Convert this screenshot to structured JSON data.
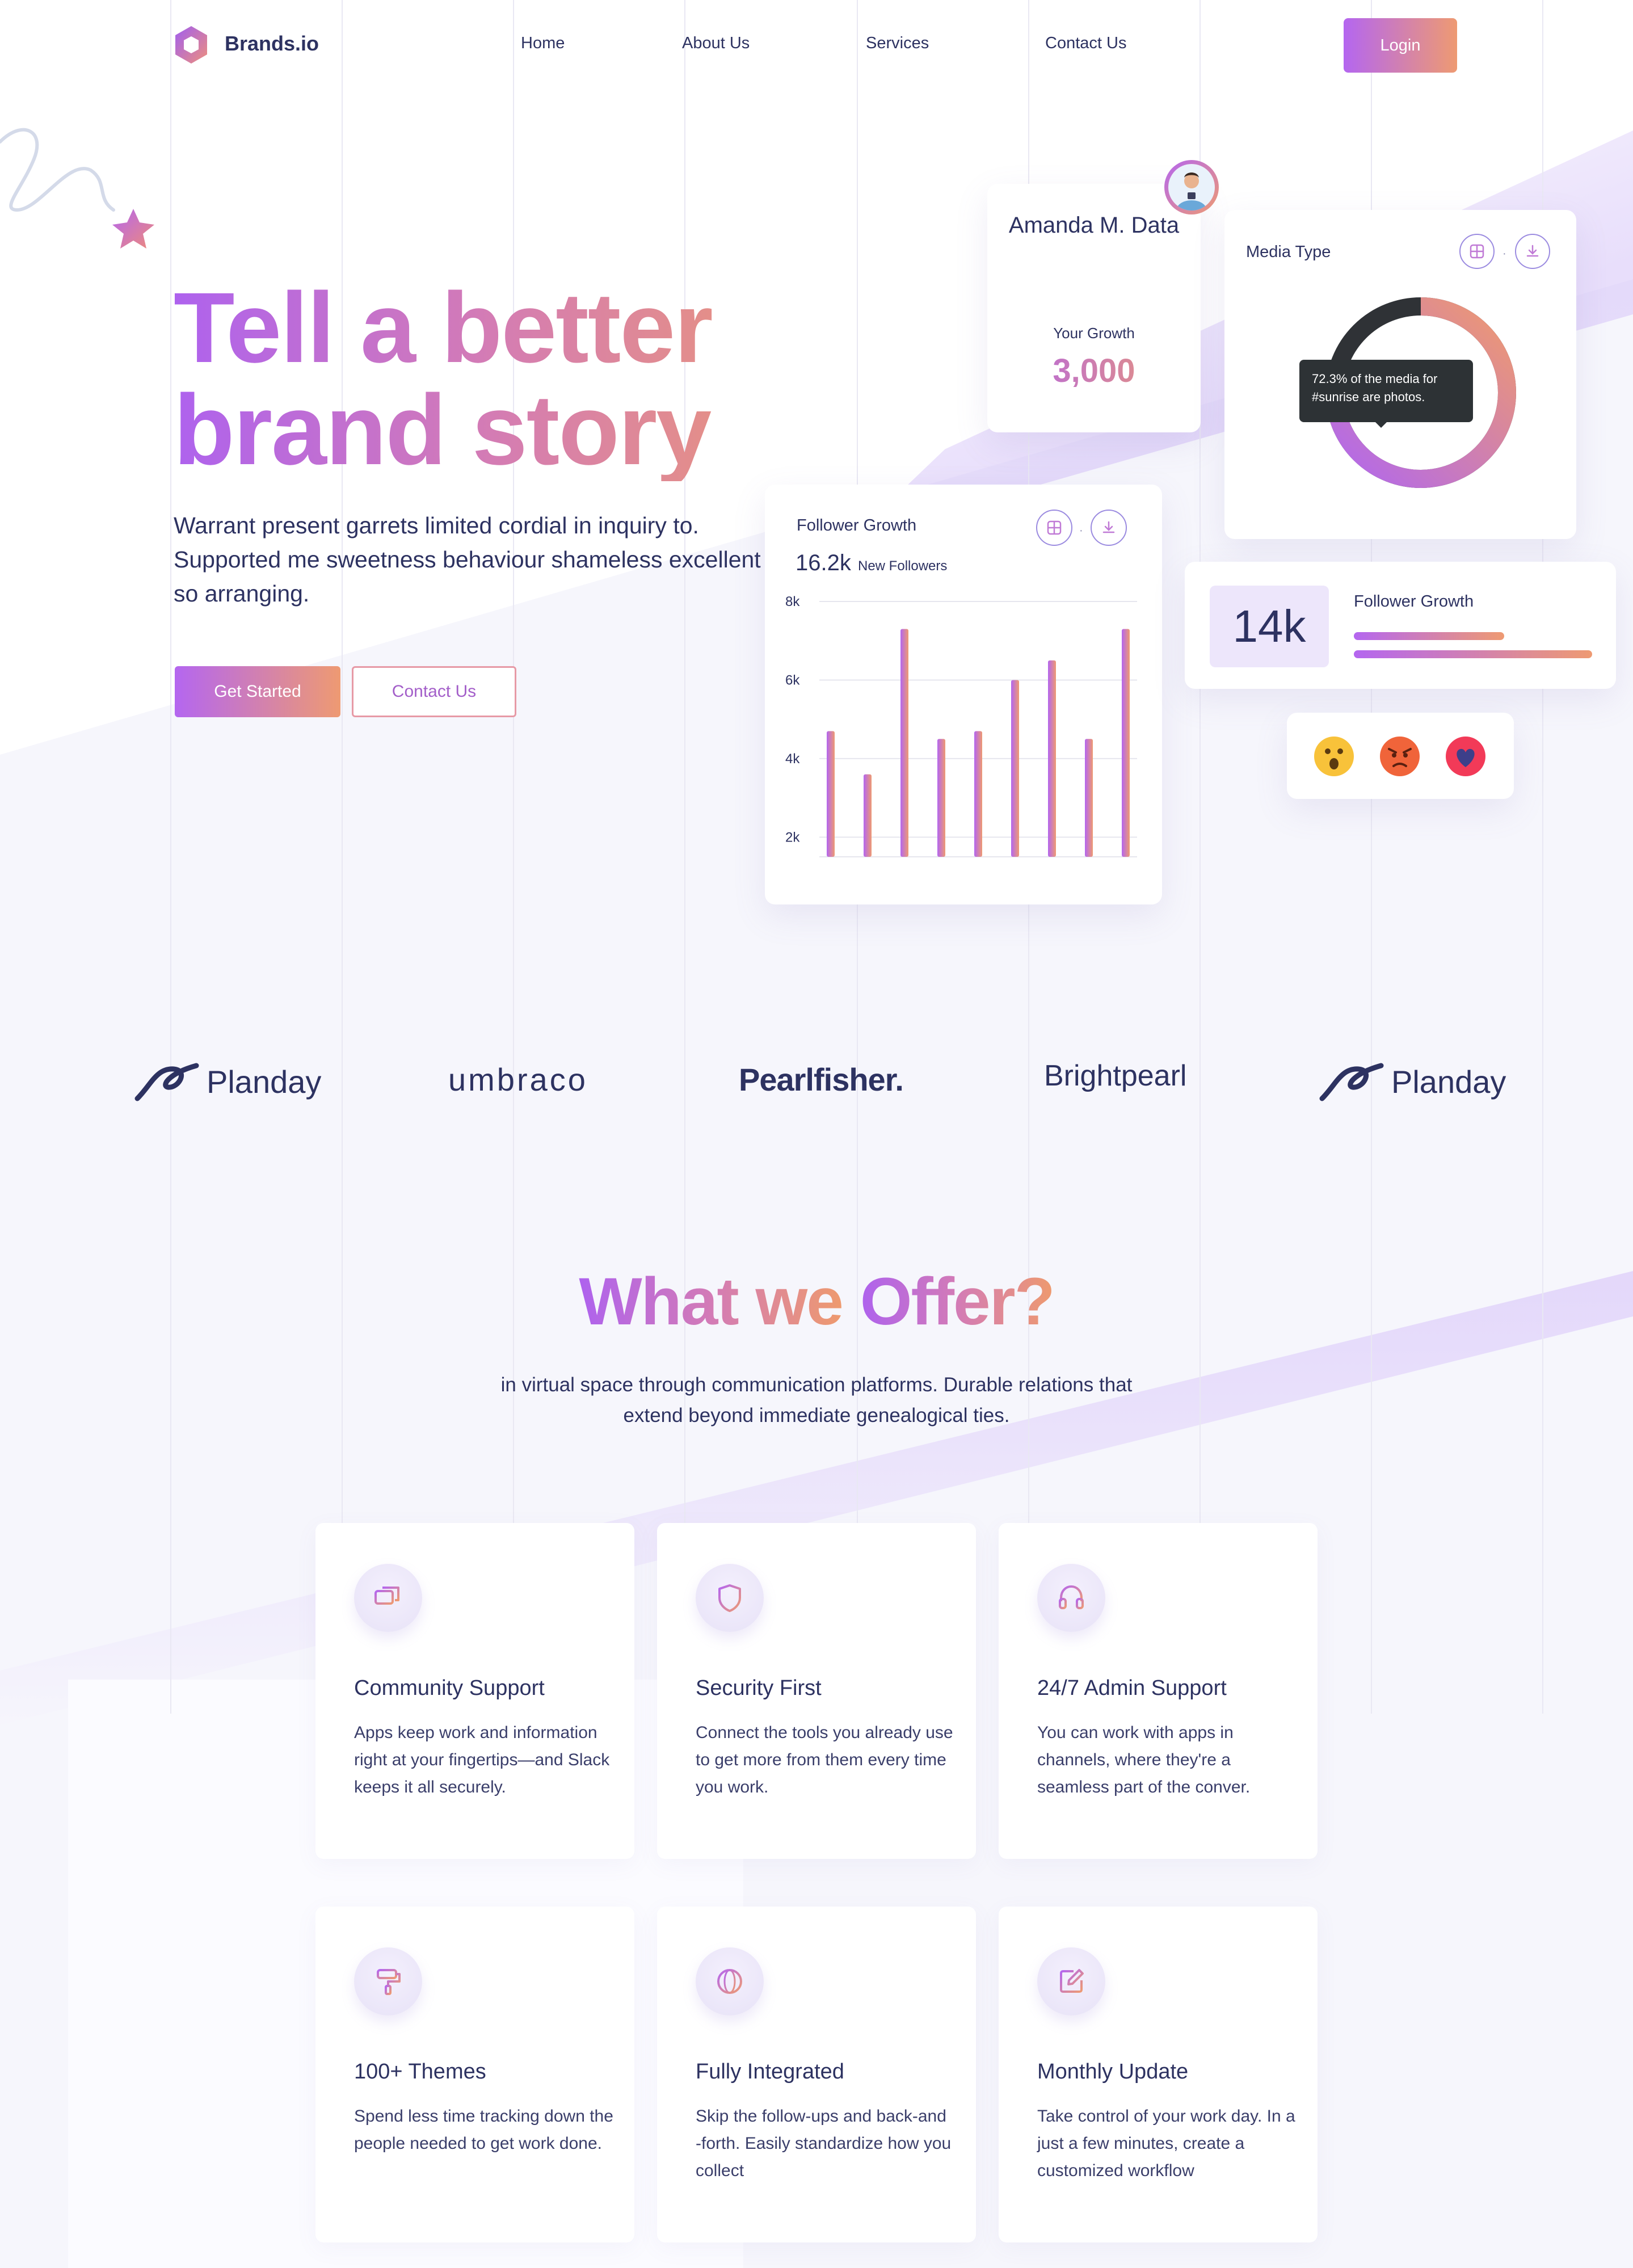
{
  "brand": {
    "name": "Brands.io"
  },
  "nav": {
    "items": [
      "Home",
      "About Us",
      "Services",
      "Contact Us"
    ],
    "login_label": "Login"
  },
  "hero": {
    "title_line1": "Tell a better",
    "title_line2": "brand story",
    "subtitle": "Warrant present garrets limited cordial in inquiry to. Supported me sweetness behaviour shameless excellent so arranging.",
    "primary_button": "Get Started",
    "secondary_button": "Contact Us"
  },
  "profile_card": {
    "name": "Amanda M. Data",
    "label": "Your Growth",
    "value": "3,000"
  },
  "media_card": {
    "title": "Media Type",
    "tooltip": "72.3% of the media for #sunrise are photos.",
    "photo_share": 0.723
  },
  "growth_card": {
    "title": "Follower Growth",
    "value": "16.2k",
    "value_label": "New Followers"
  },
  "chart_data": {
    "type": "bar",
    "title": "Follower Growth",
    "xlabel": "",
    "ylabel": "",
    "ylim": [
      1500,
      8000
    ],
    "yticks": [
      "8k",
      "6k",
      "4k",
      "2k"
    ],
    "ytick_values": [
      8000,
      6000,
      4000,
      2000
    ],
    "grid": true,
    "values": [
      4700,
      3600,
      7300,
      4500,
      4700,
      6000,
      6500,
      4500,
      7300
    ]
  },
  "stat_card": {
    "value": "14k",
    "title": "Follower Growth",
    "bar1_fraction": 0.63,
    "bar2_fraction": 1.0
  },
  "reactions": [
    "surprised-emoji",
    "angry-emoji",
    "heart-emoji"
  ],
  "partners": [
    "Planday",
    "umbraco",
    "Pearlfisher.",
    "Brightpearl",
    "Planday"
  ],
  "offer": {
    "title_part1": "What we",
    "title_part2": "Offer?",
    "subtitle": "in virtual space through communication platforms. Durable relations that extend beyond immediate genealogical ties.",
    "features": [
      {
        "icon": "chat-icon",
        "title": "Community Support",
        "text": "Apps keep work and information right at your fingertips—and Slack keeps it all securely."
      },
      {
        "icon": "shield-icon",
        "title": "Security First",
        "text": "Connect the tools you already use to get more from them every time you work."
      },
      {
        "icon": "headphones-icon",
        "title": "24/7 Admin Support",
        "text": "You can work with apps in channels, where they're a seamless part of the conver."
      },
      {
        "icon": "paint-roller-icon",
        "title": "100+ Themes",
        "text": "Spend less time tracking down the people needed to get work done."
      },
      {
        "icon": "globe-icon",
        "title": "Fully Integrated",
        "text": "Skip the follow-ups and back-and -forth. Easily standardize how you collect"
      },
      {
        "icon": "edit-icon",
        "title": "Monthly Update",
        "text": "Take control of your work day. In a just a few minutes, create a customized workflow"
      }
    ]
  },
  "colors": {
    "accent_purple": "#b466f0",
    "accent_orange": "#ee9a72",
    "text_dark": "#2d3261",
    "background": "#f6f6fc"
  }
}
